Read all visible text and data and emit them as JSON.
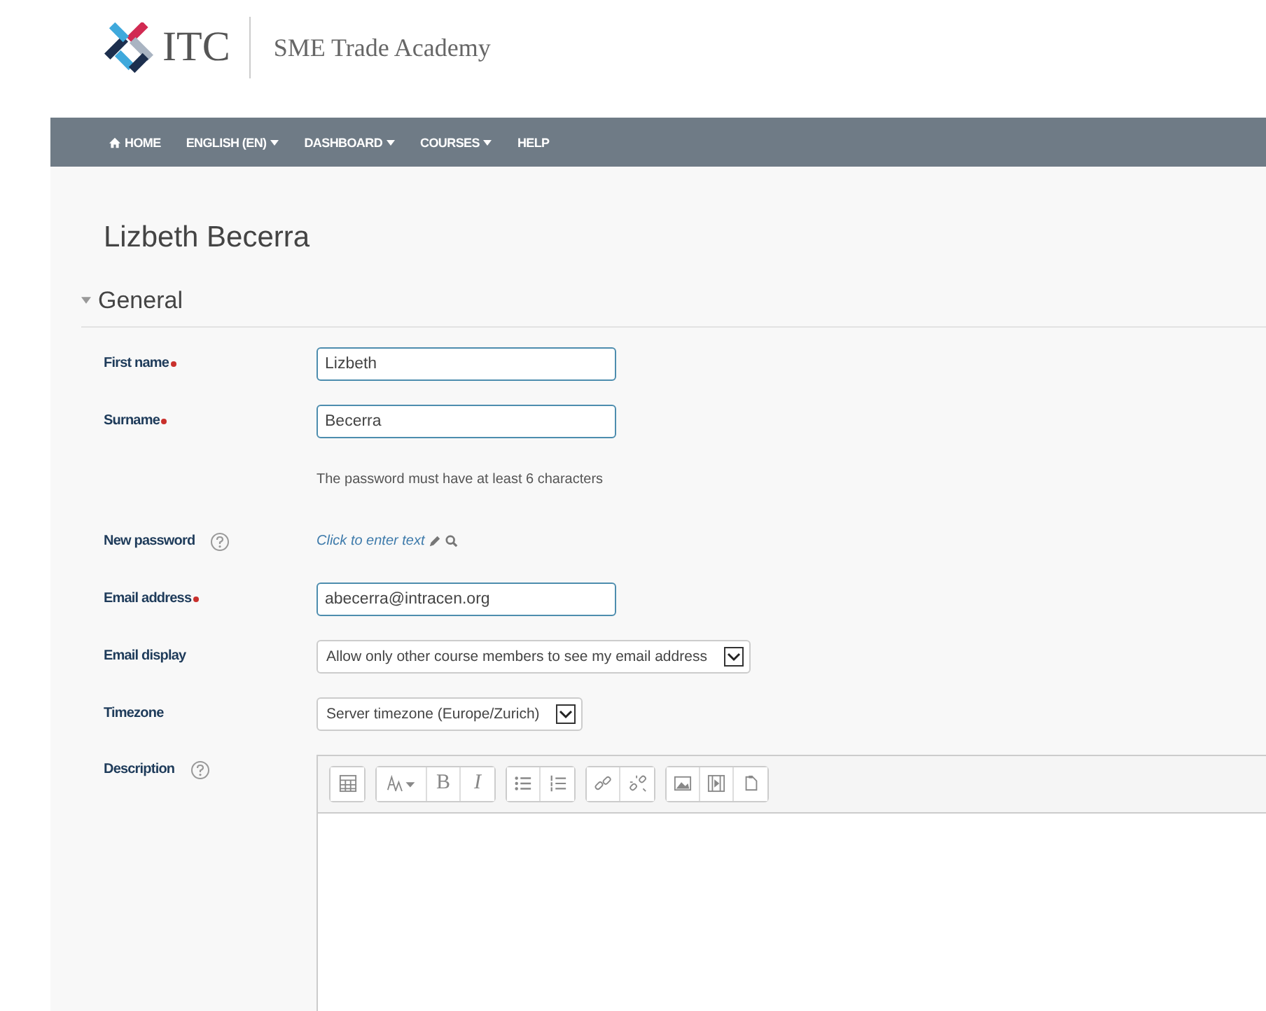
{
  "header": {
    "logo_text": "ITC",
    "site_name": "SME Trade Academy"
  },
  "nav": [
    {
      "label": "HOME",
      "kind": "home",
      "dropdown": false
    },
    {
      "label": "ENGLISH (EN)",
      "kind": "plain",
      "dropdown": true
    },
    {
      "label": "DASHBOARD",
      "kind": "plain",
      "dropdown": true
    },
    {
      "label": "COURSES",
      "kind": "plain",
      "dropdown": true
    },
    {
      "label": "HELP",
      "kind": "plain",
      "dropdown": false
    }
  ],
  "page_title": "Lizbeth Becerra",
  "section": {
    "title": "General",
    "expanded": true
  },
  "fields": [
    {
      "kind": "text",
      "label": "First name",
      "required": true,
      "help": false,
      "value": "Lizbeth"
    },
    {
      "kind": "text",
      "label": "Surname",
      "required": true,
      "help": false,
      "value": "Becerra"
    },
    {
      "kind": "note",
      "text": "The password must have at least 6 characters"
    },
    {
      "kind": "link",
      "label": "New password",
      "required": false,
      "help": true,
      "value": "Click to enter text"
    },
    {
      "kind": "text",
      "label": "Email address",
      "required": true,
      "help": false,
      "value": "abecerra@intracen.org"
    },
    {
      "kind": "select",
      "label": "Email display",
      "required": false,
      "help": false,
      "value": "Allow only other course members to see my email address"
    },
    {
      "kind": "select",
      "label": "Timezone",
      "required": false,
      "help": false,
      "value": "Server timezone (Europe/Zurich)"
    },
    {
      "kind": "editor",
      "label": "Description",
      "required": false,
      "help": true
    }
  ],
  "editor_toolbar": [
    [
      {
        "kind": "table"
      }
    ],
    [
      {
        "kind": "font"
      },
      {
        "kind": "bold",
        "label": "B"
      },
      {
        "kind": "italic",
        "label": "I"
      }
    ],
    [
      {
        "kind": "bullets"
      },
      {
        "kind": "numbers"
      }
    ],
    [
      {
        "kind": "link"
      },
      {
        "kind": "unlink"
      }
    ],
    [
      {
        "kind": "image"
      },
      {
        "kind": "media"
      },
      {
        "kind": "paste"
      }
    ]
  ]
}
